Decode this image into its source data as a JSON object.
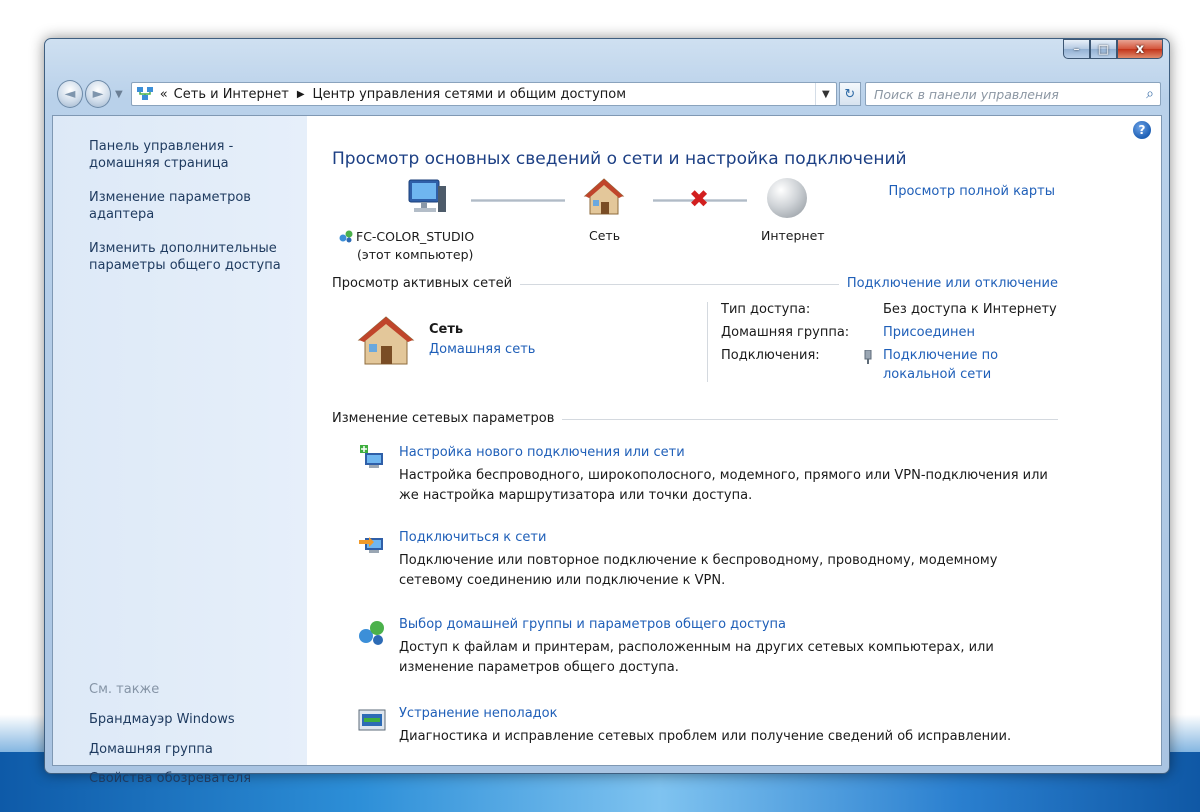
{
  "window": {
    "controls": {
      "minimize": "–",
      "maximize": "□",
      "close": "x"
    }
  },
  "navigation": {
    "back": "◄",
    "forward": "►",
    "breadcrumb_prefix": "«",
    "breadcrumb": [
      "Сеть и Интернет",
      "Центр управления сетями и общим доступом"
    ],
    "separator": "▶",
    "dropdown": "▼",
    "refresh": "↻",
    "search_placeholder": "Поиск в панели управления",
    "search_icon": "⌕"
  },
  "sidebar": {
    "links": [
      "Панель управления -\nдомашняя страница",
      "Изменение параметров\nадаптера",
      "Изменить дополнительные\nпараметры общего доступа"
    ],
    "see_also_label": "См. также",
    "see_also": [
      "Брандмауэр Windows",
      "Домашняя группа",
      "Свойства обозревателя"
    ]
  },
  "main": {
    "help": "?",
    "title": "Просмотр основных сведений о сети и настройка подключений",
    "full_map_link": "Просмотр полной карты",
    "map": {
      "computer_name": "FC-COLOR_STUDIO",
      "computer_sub": "(этот компьютер)",
      "network_name": "Сеть",
      "internet_name": "Интернет",
      "x_mark": "✖"
    },
    "active_networks": {
      "title": "Просмотр активных сетей",
      "connect_link": "Подключение или отключение",
      "network_name": "Сеть",
      "network_type": "Домашняя сеть",
      "access_type_label": "Тип доступа:",
      "access_type_value": "Без доступа к Интернету",
      "homegroup_label": "Домашняя группа:",
      "homegroup_value": "Присоединен",
      "connections_label": "Подключения:",
      "connection_value_line1": "Подключение по",
      "connection_value_line2": "локальной сети"
    },
    "change_settings": {
      "title": "Изменение сетевых параметров",
      "tasks": [
        {
          "link": "Настройка нового подключения или сети",
          "desc": "Настройка беспроводного, широкополосного, модемного, прямого или VPN-подключения или же настройка маршрутизатора или точки доступа."
        },
        {
          "link": "Подключиться к сети",
          "desc": "Подключение или повторное подключение к беспроводному, проводному, модемному сетевому соединению или подключение к VPN."
        },
        {
          "link": "Выбор домашней группы и параметров общего доступа",
          "desc": "Доступ к файлам и принтерам, расположенным на других сетевых компьютерах, или изменение параметров общего доступа."
        },
        {
          "link": "Устранение неполадок",
          "desc": "Диагностика и исправление сетевых проблем или получение сведений об исправлении."
        }
      ]
    }
  }
}
